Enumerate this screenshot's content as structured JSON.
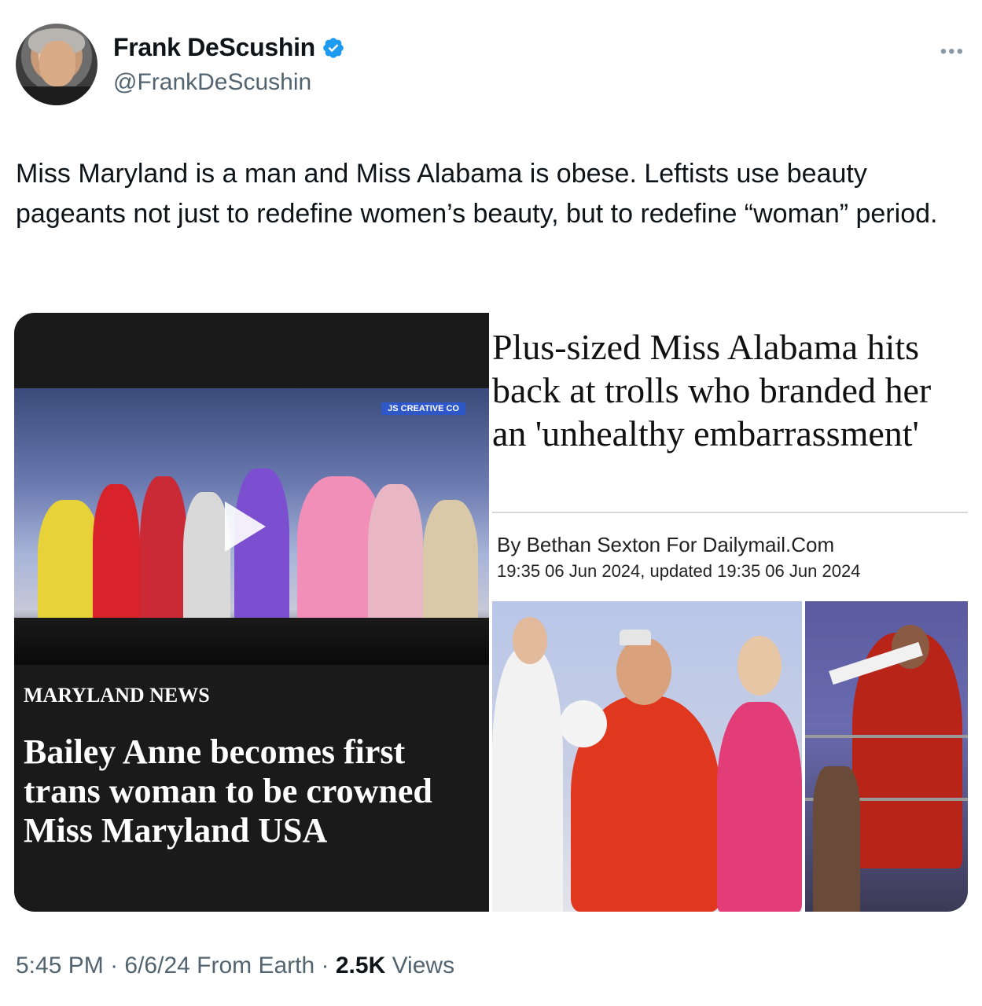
{
  "author": {
    "display_name": "Frank DeScushin",
    "handle": "@FrankDeScushin",
    "verified": true,
    "verified_color": "#1d9bf0"
  },
  "more_label": "•••",
  "tweet": {
    "text": "Miss Maryland is a man and Miss Alabama is obese. Leftists use beauty pageants not just to redefine women’s beauty, but to redefine “woman” period."
  },
  "media": {
    "left": {
      "watermark": "JS CREATIVE CO",
      "kicker": "MARYLAND NEWS",
      "headline": "Bailey Anne becomes first trans woman to be crowned Miss Maryland USA"
    },
    "right": {
      "headline": "Plus-sized Miss Alabama hits back at trolls who branded her an 'unhealthy embarrassment'",
      "byline": "By Bethan Sexton For Dailymail.Com",
      "dates": "19:35 06 Jun 2024, updated 19:35 06 Jun 2024"
    }
  },
  "footer": {
    "time": "5:45 PM",
    "sep1": " · ",
    "date": "6/6/24",
    "source": " From Earth",
    "sep2": " · ",
    "views_count": "2.5K",
    "views_label": " Views"
  }
}
